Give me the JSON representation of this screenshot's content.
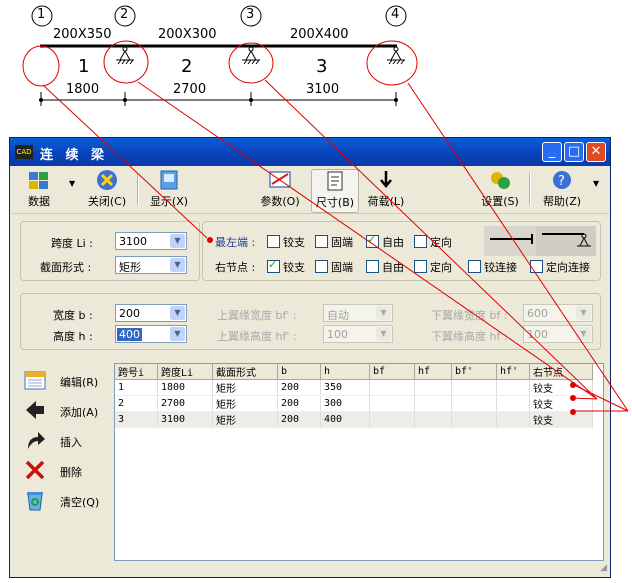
{
  "diagram": {
    "node_numbers": [
      "1",
      "2",
      "3",
      "4"
    ],
    "section_labels": [
      "200X350",
      "200X300",
      "200X400"
    ],
    "span_numbers": [
      "1",
      "2",
      "3"
    ],
    "span_lengths": [
      "1800",
      "2700",
      "3100"
    ]
  },
  "window": {
    "title": "连 续 梁",
    "icon_text": "CAD"
  },
  "toolbar": {
    "data": "数据",
    "close": "关闭(C)",
    "display": "显示(X)",
    "params": "参数(O)",
    "size": "尺寸(B)",
    "load": "荷载(L)",
    "settings": "设置(S)",
    "help": "帮助(Z)"
  },
  "span_group": {
    "span_label": "跨度 Li :",
    "span_value": "3100",
    "section_label": "截面形式 :",
    "section_value": "矩形"
  },
  "support_group": {
    "left_label": "最左端 :",
    "right_label": "右节点 :",
    "left_options": [
      {
        "label": "铰支",
        "checked": false
      },
      {
        "label": "固端",
        "checked": false
      },
      {
        "label": "自由",
        "checked": true
      },
      {
        "label": "定向",
        "checked": false
      }
    ],
    "right_options": [
      {
        "label": "铰支",
        "checked": true
      },
      {
        "label": "固端",
        "checked": false
      },
      {
        "label": "自由",
        "checked": false
      },
      {
        "label": "定向",
        "checked": false
      },
      {
        "label": "铰连接",
        "checked": false
      },
      {
        "label": "定向连接",
        "checked": false
      }
    ]
  },
  "size_group": {
    "width_label": "宽度 b :",
    "width_value": "200",
    "height_label": "高度 h :",
    "height_value": "400",
    "top_flange_width_label": "上翼缘宽度 bf' :",
    "top_flange_width_value": "自动",
    "top_flange_height_label": "上翼缘高度 hf' :",
    "top_flange_height_value": "100",
    "bottom_flange_width_label": "下翼缘宽度 bf :",
    "bottom_flange_width_value": "600",
    "bottom_flange_height_label": "下翼缘高度 hf :",
    "bottom_flange_height_value": "100"
  },
  "side_actions": {
    "edit": "编辑(R)",
    "add": "添加(A)",
    "insert": "插入",
    "delete": "删除",
    "clear": "清空(Q)"
  },
  "table": {
    "headers": [
      "跨号i",
      "跨度Li",
      "截面形式",
      "b",
      "h",
      "bf",
      "hf",
      "bf'",
      "hf'",
      "右节点"
    ],
    "rows": [
      [
        "1",
        "1800",
        "矩形",
        "200",
        "350",
        "",
        "",
        "",
        "",
        "铰支"
      ],
      [
        "2",
        "2700",
        "矩形",
        "200",
        "300",
        "",
        "",
        "",
        "",
        "铰支"
      ],
      [
        "3",
        "3100",
        "矩形",
        "200",
        "400",
        "",
        "",
        "",
        "",
        "铰支"
      ]
    ]
  },
  "colors": {
    "annotation_red": "#e00000",
    "title_blue": "#0a5fd8",
    "face": "#ece9d8"
  }
}
